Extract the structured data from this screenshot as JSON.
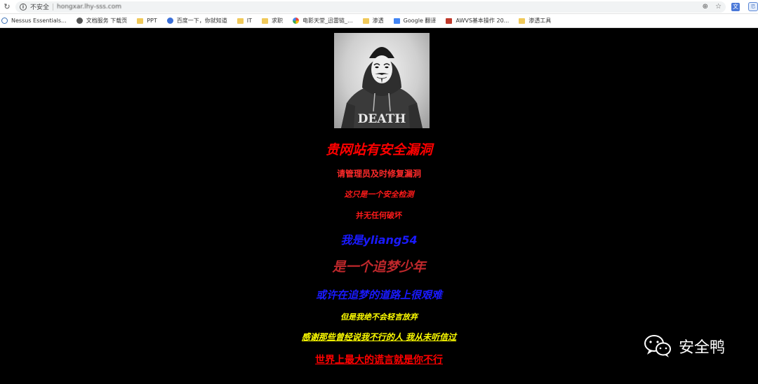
{
  "browser": {
    "insecure_label": "不安全",
    "url": "hongxar.lhy-sss.com"
  },
  "bookmarks": [
    {
      "label": "Nessus Essentials...",
      "icon": "globe-icon"
    },
    {
      "label": "文档服务 下载页",
      "icon": "site-icon"
    },
    {
      "label": "PPT",
      "icon": "folder-icon"
    },
    {
      "label": "百度一下，你就知道",
      "icon": "baidu-icon"
    },
    {
      "label": "IT",
      "icon": "folder-icon"
    },
    {
      "label": "求职",
      "icon": "folder-icon"
    },
    {
      "label": "电影天堂_迅雷链_...",
      "icon": "site-icon"
    },
    {
      "label": "渗透",
      "icon": "folder-icon"
    },
    {
      "label": "Google 翻译",
      "icon": "translate-icon"
    },
    {
      "label": "AWVS基本操作 20...",
      "icon": "site-icon"
    },
    {
      "label": "渗透工具",
      "icon": "folder-icon"
    }
  ],
  "page": {
    "lines": [
      "贵网站有安全漏洞",
      "请管理员及时修复漏洞",
      "这只是一个安全检测",
      "并无任何破坏",
      "我是yliang54",
      "是一个追梦少年",
      "或许在追梦的道路上很艰难",
      "但是我绝不会轻言放弃",
      "感谢那些曾经说我不行的人 我从未听信过",
      "世界上最大的谎言就是你不行"
    ],
    "image_caption": "DEATH"
  },
  "watermark": {
    "text": "安全鸭"
  }
}
